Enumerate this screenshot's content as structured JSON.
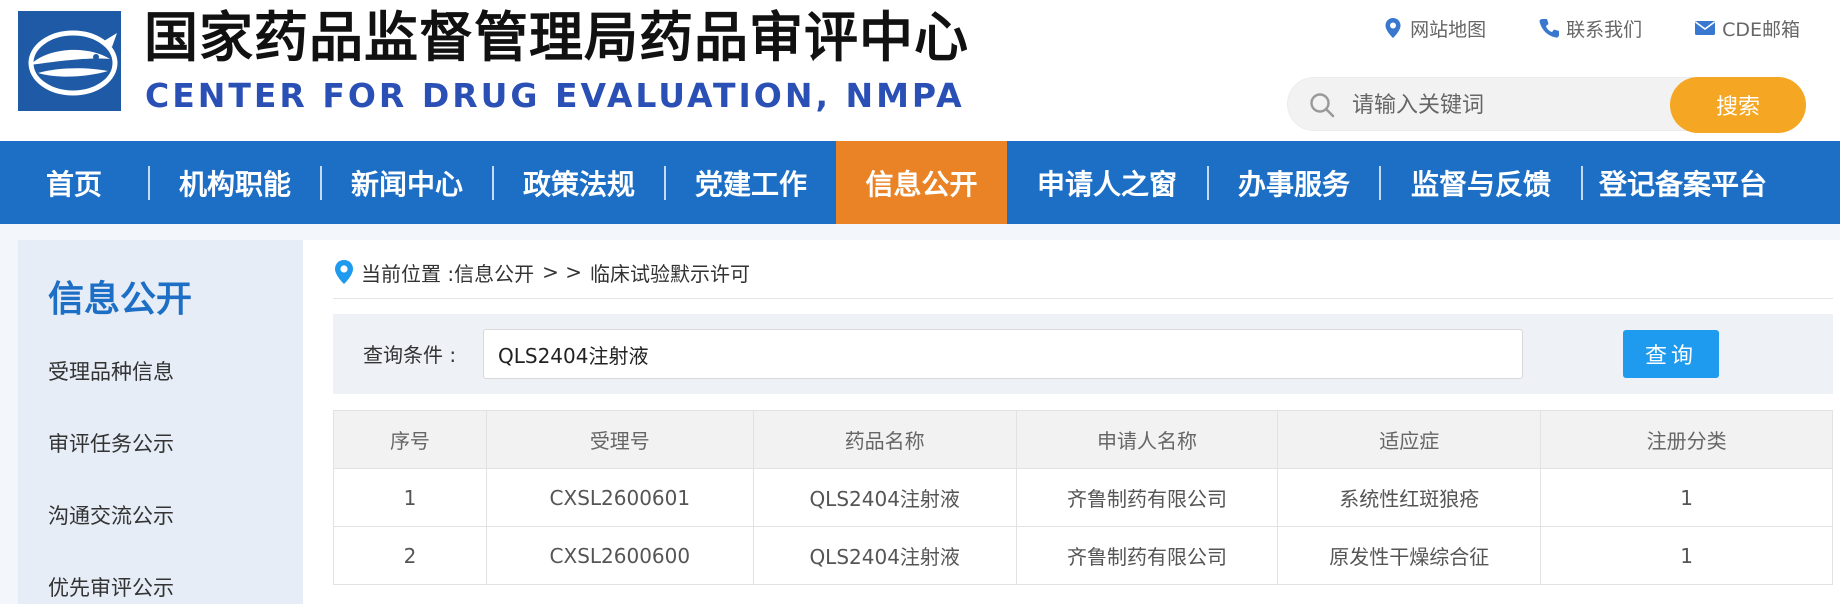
{
  "site": {
    "title_cn": "国家药品监督管理局药品审评中心",
    "title_en": "CENTER FOR DRUG EVALUATION, NMPA",
    "logo_icon": "fish-logo-icon",
    "colors": {
      "brand_blue": "#1d6fc6",
      "nav_active": "#e98325",
      "search_button": "#f5a623",
      "query_button": "#1e9bef"
    }
  },
  "toplinks": [
    {
      "label": "网站地图",
      "icon": "map-pin-icon"
    },
    {
      "label": "联系我们",
      "icon": "phone-icon"
    },
    {
      "label": "CDE邮箱",
      "icon": "mail-icon"
    }
  ],
  "search": {
    "placeholder": "请输入关键词",
    "button": "搜索"
  },
  "nav": [
    {
      "label": "首页"
    },
    {
      "label": "机构职能"
    },
    {
      "label": "新闻中心"
    },
    {
      "label": "政策法规"
    },
    {
      "label": "党建工作"
    },
    {
      "label": "信息公开",
      "active": true
    },
    {
      "label": "申请人之窗"
    },
    {
      "label": "办事服务"
    },
    {
      "label": "监督与反馈"
    },
    {
      "label": "登记备案平台"
    }
  ],
  "sidebar": {
    "title": "信息公开",
    "items": [
      "受理品种信息",
      "审评任务公示",
      "沟通交流公示",
      "优先审评公示"
    ]
  },
  "breadcrumb": {
    "prefix": "当前位置 : ",
    "section": "信息公开",
    "sep": "> >",
    "current": "临床试验默示许可"
  },
  "query": {
    "label": "查询条件 :",
    "value": "QLS2404注射液",
    "button": "查询"
  },
  "table": {
    "headers": [
      "序号",
      "受理号",
      "药品名称",
      "申请人名称",
      "适应症",
      "注册分类"
    ],
    "rows": [
      [
        "1",
        "CXSL2600601",
        "QLS2404注射液",
        "齐鲁制药有限公司",
        "系统性红斑狼疮",
        "1"
      ],
      [
        "2",
        "CXSL2600600",
        "QLS2404注射液",
        "齐鲁制药有限公司",
        "原发性干燥综合征",
        "1"
      ]
    ]
  }
}
